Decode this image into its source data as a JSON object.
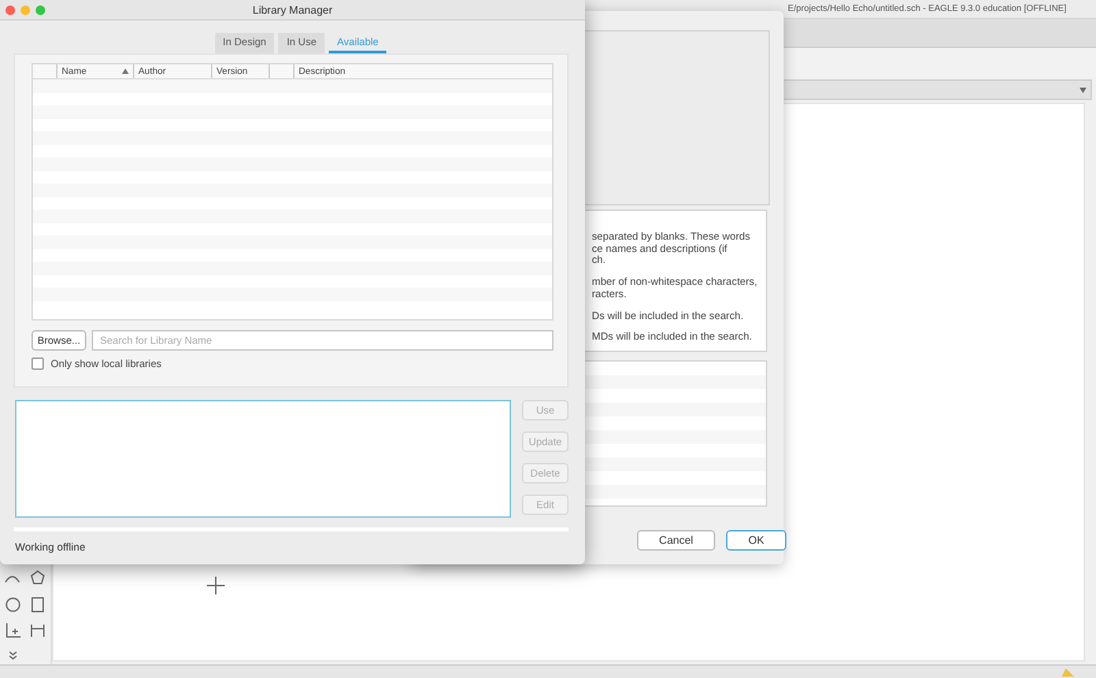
{
  "main_window": {
    "title": "E/projects/Hello Echo/untitled.sch - EAGLE 9.3.0 education [OFFLINE]"
  },
  "dialog": {
    "help_lines": [
      "separated by blanks. These words",
      "ce names and descriptions (if",
      "ch.",
      "mber of non-whitespace characters,",
      "racters.",
      "Ds will be included in the search.",
      "MDs will be included in the search."
    ],
    "buttons": [
      {
        "label": "Cancel",
        "default": false
      },
      {
        "label": "OK",
        "default": true
      }
    ]
  },
  "library_manager": {
    "title": "Library Manager",
    "tabs": [
      {
        "label": "In Design",
        "selected": false
      },
      {
        "label": "In Use",
        "selected": false
      },
      {
        "label": "Available",
        "selected": true
      }
    ],
    "columns": [
      {
        "label": "Name",
        "sorted": true
      },
      {
        "label": "Author",
        "sorted": false
      },
      {
        "label": "Version",
        "sorted": false
      },
      {
        "label": "Description",
        "sorted": false
      }
    ],
    "browse_button": "Browse...",
    "search": {
      "placeholder": "Search for Library Name"
    },
    "local_only": {
      "label": "Only show local libraries",
      "checked": false
    },
    "actions": [
      {
        "label": "Use",
        "disabled": true
      },
      {
        "label": "Update",
        "disabled": true
      },
      {
        "label": "Delete",
        "disabled": true
      },
      {
        "label": "Edit",
        "disabled": true
      }
    ],
    "status": "Working offline"
  }
}
